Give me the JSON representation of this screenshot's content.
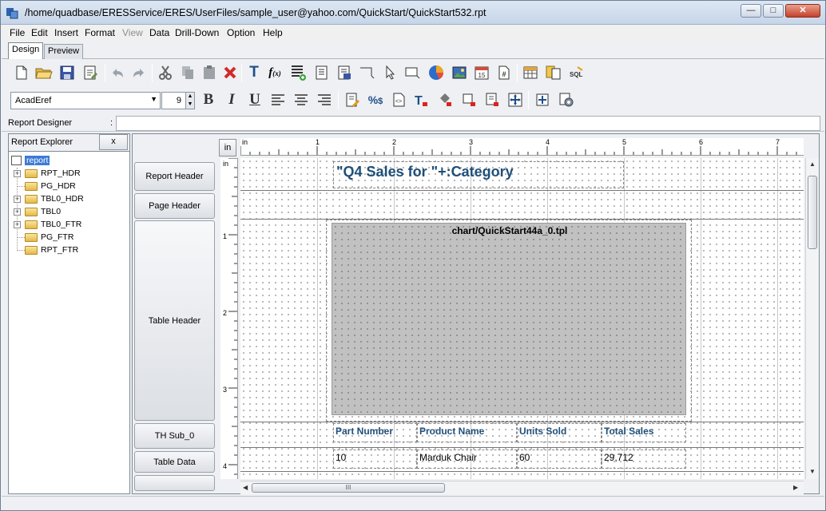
{
  "window": {
    "title": "/home/quadbase/ERESService/ERES/UserFiles/sample_user@yahoo.com/QuickStart/QuickStart532.rpt",
    "minimize": "—",
    "maximize": "□",
    "close": "✕"
  },
  "menu": [
    "File",
    "Edit",
    "Insert",
    "Format",
    "View",
    "Data",
    "Drill-Down",
    "Option",
    "Help"
  ],
  "tabs": [
    "Design",
    "Preview"
  ],
  "format_bar": {
    "font": "AcadEref",
    "size": "9",
    "bold": "B",
    "italic": "I",
    "underline": "U"
  },
  "property_bar": {
    "label": "Report Designer",
    "colon": ":",
    "value": ""
  },
  "explorer": {
    "title": "Report Explorer",
    "close": "x",
    "root": "report",
    "nodes": [
      "RPT_HDR",
      "PG_HDR",
      "TBL0_HDR",
      "TBL0",
      "TBL0_FTR",
      "PG_FTR",
      "RPT_FTR"
    ]
  },
  "sections": [
    "Report Header",
    "Page Header",
    "Table Header",
    "TH Sub_0",
    "Table Data"
  ],
  "unit_button": "in",
  "ruler": {
    "unit": "in",
    "top_labels": [
      "1",
      "2",
      "3",
      "4",
      "5",
      "6",
      "7"
    ],
    "left_labels": [
      "1",
      "2",
      "3",
      "4"
    ]
  },
  "canvas": {
    "title_text": "\"Q4 Sales for \"+:Category",
    "chart_label": "chart/QuickStart44a_0.tpl",
    "headers": [
      "Part Number",
      "Product Name",
      "Units Sold",
      "Total Sales"
    ],
    "row": [
      "10",
      "Marduk Chair",
      "60",
      "29,712"
    ]
  },
  "colors": {
    "title_text": "#1f4f78",
    "chart_fill": "#c1c1c1"
  }
}
